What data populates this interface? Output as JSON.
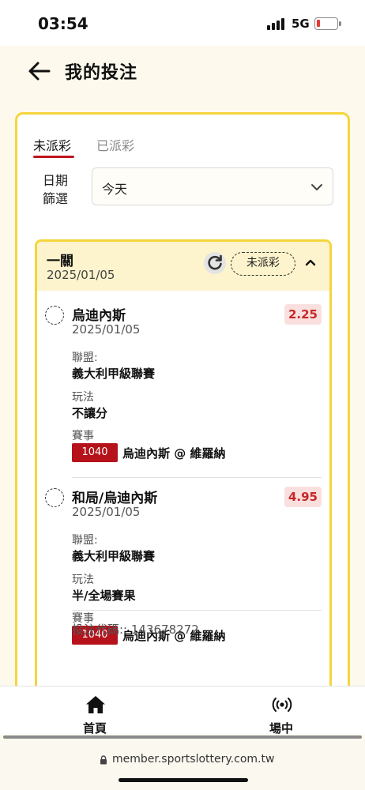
{
  "status_bar": {
    "time": "03:54",
    "network": "5G",
    "battery_color": "#e53935"
  },
  "header": {
    "title": "我的投注",
    "back_icon": "arrow-left-icon"
  },
  "tabs": [
    {
      "label": "未派彩",
      "active": true
    },
    {
      "label": "已派彩",
      "active": false
    }
  ],
  "date_filter": {
    "label": "日期篩選",
    "selected": "今天"
  },
  "bet": {
    "type": "一關",
    "date": "2025/01/05",
    "status": "未派彩",
    "selections": [
      {
        "name": "烏迪內斯",
        "date": "2025/01/05",
        "odds": "2.25",
        "league_label": "聯盟:",
        "league": "義大利甲級聯賽",
        "play_label": "玩法",
        "play": "不讓分",
        "match_label": "賽事",
        "match_code": "1040",
        "match": "烏迪內斯 @ 維羅納"
      },
      {
        "name": "和局/烏迪內斯",
        "date": "2025/01/05",
        "odds": "4.95",
        "league_label": "聯盟:",
        "league": "義大利甲級聯賽",
        "play_label": "玩法",
        "play": "半/全場賽果",
        "match_label": "賽事",
        "match_code": "1040",
        "match": "烏迪內斯 @ 維羅納"
      }
    ],
    "bet_code": "投注代碼:: 143678272"
  },
  "bottom_nav": [
    {
      "label": "首頁",
      "icon": "home-icon"
    },
    {
      "label": "場中",
      "icon": "live-broadcast-icon"
    }
  ],
  "url": "member.sportslottery.com.tw",
  "colors": {
    "accent_yellow": "#f5d53b",
    "brand_red": "#c0151b",
    "code_red": "#b5121b",
    "odds_red": "#c62828"
  }
}
